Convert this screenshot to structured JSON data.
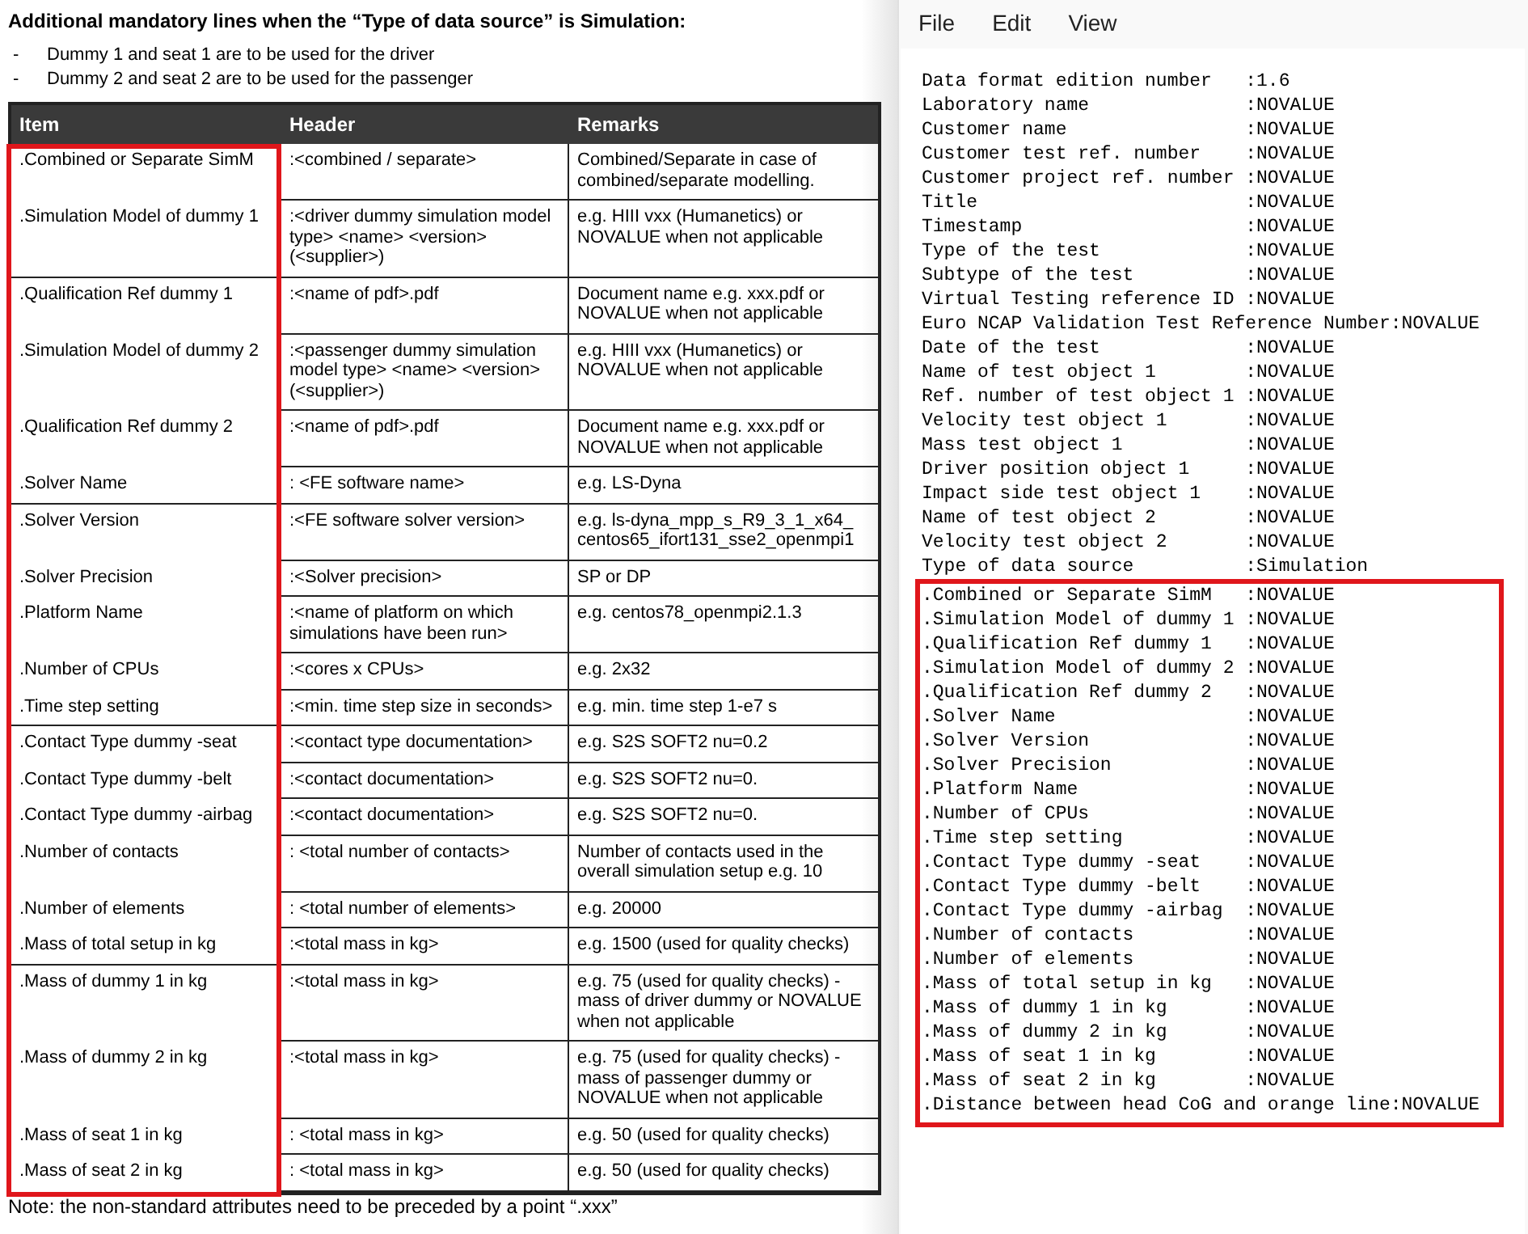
{
  "document": {
    "heading": "Additional mandatory lines when the “Type of data source” is Simulation:",
    "bullets": [
      {
        "marker": "-",
        "text": "Dummy 1 and seat 1 are to be used for the driver"
      },
      {
        "marker": "-",
        "text": "Dummy 2 and seat 2 are to be used for the passenger"
      }
    ],
    "table": {
      "columns": [
        "Item",
        "Header",
        "Remarks"
      ],
      "highlight_item_column": true,
      "rows": [
        {
          "item": ".Combined or Separate SimM",
          "header": ":<combined / separate>",
          "remarks": "Combined/Separate in case of combined/separate modelling.",
          "group_end": false
        },
        {
          "item": ".Simulation Model of dummy 1",
          "header": ":<driver dummy simulation model type> <name> <version> (<supplier>)",
          "remarks": "e.g. HIII vxx (Humanetics) or NOVALUE when not applicable",
          "group_end": true
        },
        {
          "item": ".Qualification Ref dummy 1",
          "header": ":<name of pdf>.pdf",
          "remarks": "Document name e.g. xxx.pdf or NOVALUE when not applicable",
          "group_end": false
        },
        {
          "item": ".Simulation Model of dummy 2",
          "header": ":<passenger dummy simulation model type> <name> <version> (<supplier>)",
          "remarks": "e.g. HIII vxx (Humanetics) or NOVALUE when not applicable",
          "group_end": false
        },
        {
          "item": ".Qualification Ref dummy 2",
          "header": ":<name of pdf>.pdf",
          "remarks": "Document name e.g. xxx.pdf or NOVALUE when not applicable",
          "group_end": false
        },
        {
          "item": ".Solver Name",
          "header": ": <FE software name>",
          "remarks": "e.g. LS-Dyna",
          "group_end": true
        },
        {
          "item": ".Solver Version",
          "header": ":<FE software solver version>",
          "remarks": "e.g. ls-dyna_mpp_s_R9_3_1_x64_ centos65_ifort131_sse2_openmpi1",
          "group_end": false
        },
        {
          "item": ".Solver Precision",
          "header": ":<Solver precision>",
          "remarks": "SP or DP",
          "group_end": false
        },
        {
          "item": ".Platform Name",
          "header": ":<name of platform on which simulations have been run>",
          "remarks": "e.g. centos78_openmpi2.1.3",
          "group_end": false
        },
        {
          "item": ".Number of CPUs",
          "header": ":<cores x CPUs>",
          "remarks": "e.g. 2x32",
          "group_end": false
        },
        {
          "item": ".Time step setting",
          "header": ":<min. time step size in seconds>",
          "remarks": "e.g. min. time step 1-e7 s",
          "group_end": true
        },
        {
          "item": ".Contact Type dummy -seat",
          "header": ":<contact type documentation>",
          "remarks": "e.g. S2S SOFT2 nu=0.2",
          "group_end": false
        },
        {
          "item": ".Contact Type dummy -belt",
          "header": ":<contact documentation>",
          "remarks": "e.g. S2S SOFT2 nu=0.",
          "group_end": false
        },
        {
          "item": ".Contact Type dummy -airbag",
          "header": ":<contact documentation>",
          "remarks": "e.g. S2S SOFT2 nu=0.",
          "group_end": false
        },
        {
          "item": ".Number of contacts",
          "header": ": <total number of contacts>",
          "remarks": "Number of contacts used in the overall simulation setup e.g. 10",
          "group_end": false
        },
        {
          "item": ".Number of elements",
          "header": ": <total number of elements>",
          "remarks": "e.g. 20000",
          "group_end": false
        },
        {
          "item": ".Mass of total setup in kg",
          "header": ":<total mass in kg>",
          "remarks": "e.g. 1500 (used for quality checks)",
          "group_end": true
        },
        {
          "item": ".Mass of dummy 1 in kg",
          "header": ":<total mass in kg>",
          "remarks": "e.g. 75 (used for quality checks) - mass of driver dummy or NOVALUE when not applicable",
          "group_end": false
        },
        {
          "item": ".Mass of dummy 2 in kg",
          "header": ":<total mass in kg>",
          "remarks": "e.g. 75 (used for quality checks) - mass of passenger dummy or NOVALUE when not applicable",
          "group_end": false
        },
        {
          "item": ".Mass of seat 1 in kg",
          "header": ": <total mass in kg>",
          "remarks": "e.g. 50 (used for quality checks)",
          "group_end": false
        },
        {
          "item": ".Mass of seat 2 in kg",
          "header": ": <total mass in kg>",
          "remarks": "e.g. 50 (used for quality checks)",
          "group_end": false
        }
      ]
    },
    "note": "Note: the non-standard attributes need to be preceded by a point “.xxx”"
  },
  "editor": {
    "menu": [
      "File",
      "Edit",
      "View"
    ],
    "lines": [
      "Data format edition number   :1.6",
      "Laboratory name              :NOVALUE",
      "Customer name                :NOVALUE",
      "Customer test ref. number    :NOVALUE",
      "Customer project ref. number :NOVALUE",
      "Title                        :NOVALUE",
      "Timestamp                    :NOVALUE",
      "Type of the test             :NOVALUE",
      "Subtype of the test          :NOVALUE",
      "Virtual Testing reference ID :NOVALUE",
      "Euro NCAP Validation Test Reference Number:NOVALUE",
      "Date of the test             :NOVALUE",
      "Name of test object 1        :NOVALUE",
      "Ref. number of test object 1 :NOVALUE",
      "Velocity test object 1       :NOVALUE",
      "Mass test object 1           :NOVALUE",
      "Driver position object 1     :NOVALUE",
      "Impact side test object 1    :NOVALUE",
      "Name of test object 2        :NOVALUE",
      "Velocity test object 2       :NOVALUE",
      "Type of data source          :Simulation"
    ],
    "highlighted_lines": [
      ".Combined or Separate SimM   :NOVALUE",
      ".Simulation Model of dummy 1 :NOVALUE",
      ".Qualification Ref dummy 1   :NOVALUE",
      ".Simulation Model of dummy 2 :NOVALUE",
      ".Qualification Ref dummy 2   :NOVALUE",
      ".Solver Name                 :NOVALUE",
      ".Solver Version              :NOVALUE",
      ".Solver Precision            :NOVALUE",
      ".Platform Name               :NOVALUE",
      ".Number of CPUs              :NOVALUE",
      ".Time step setting           :NOVALUE",
      ".Contact Type dummy -seat    :NOVALUE",
      ".Contact Type dummy -belt    :NOVALUE",
      ".Contact Type dummy -airbag  :NOVALUE",
      ".Number of contacts          :NOVALUE",
      ".Number of elements          :NOVALUE",
      ".Mass of total setup in kg   :NOVALUE",
      ".Mass of dummy 1 in kg       :NOVALUE",
      ".Mass of dummy 2 in kg       :NOVALUE",
      ".Mass of seat 1 in kg        :NOVALUE",
      ".Mass of seat 2 in kg        :NOVALUE",
      ".Distance between head CoG and orange line:NOVALUE"
    ]
  }
}
